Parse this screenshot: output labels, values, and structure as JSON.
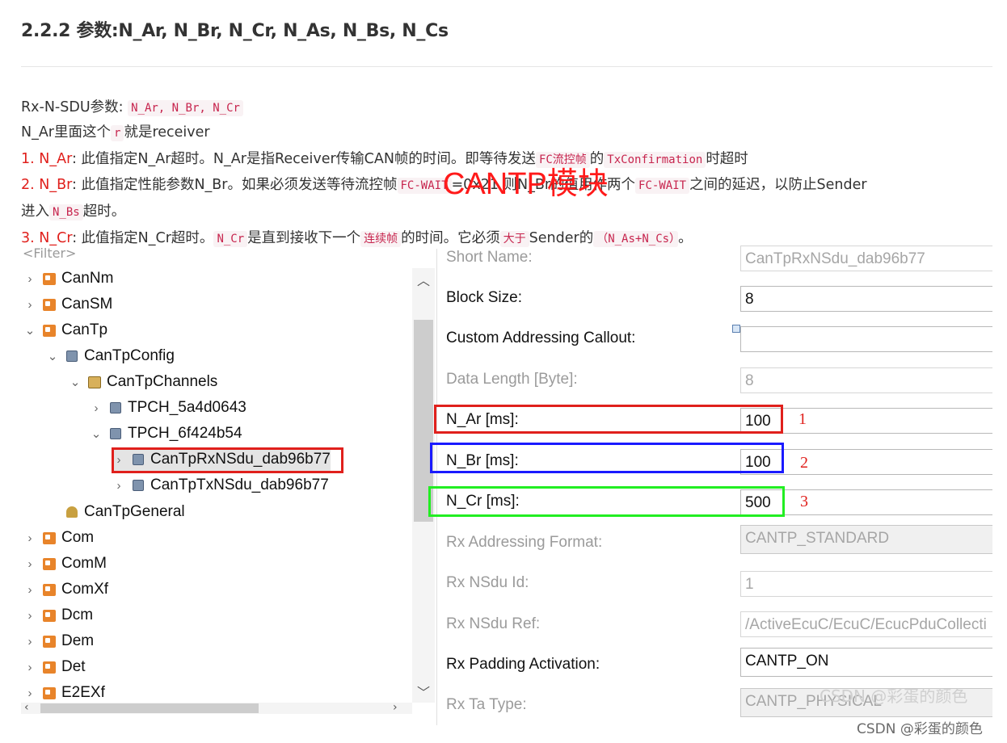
{
  "heading": "2.2.2 参数:N_Ar, N_Br, N_Cr, N_As, N_Bs, N_Cs",
  "text": {
    "l1_prefix": "Rx-N-SDU参数: ",
    "l1_code": "N_Ar, N_Br, N_Cr",
    "l2_prefix": "N_Ar里面这个",
    "l2_code": "r",
    "l2_suffix": "就是receiver",
    "l3_num": "1. N_Ar",
    "l3_a": ": 此值指定N_Ar超时。N_Ar是指Receiver传输CAN帧的时间。即等待发送",
    "l3_code1": "FC流控帧",
    "l3_b": "的",
    "l3_code2": "TxConfirmation",
    "l3_c": "时超时",
    "l4_num": "2. N_Br",
    "l4_a": ": 此值指定性能参数N_Br。如果必须发送等待流控帧",
    "l4_code1": "FC-WAIT",
    "l4_b": "=0x21 则N_Br的值用作两个",
    "l4_code2": "FC-WAIT",
    "l4_c": "之间的延迟，以防止Sender",
    "l5_a": "进入",
    "l5_code": "N_Bs",
    "l5_b": "超时。",
    "l6_num": "3. N_Cr",
    "l6_a": ": 此值指定N_Cr超时。",
    "l6_code1": "N_Cr",
    "l6_b": "是直到接收下一个",
    "l6_code2": "连续帧",
    "l6_c": "的时间。它必须",
    "l6_code3": "大于",
    "l6_d": "Sender的",
    "l6_code4": "（N_As+N_Cs）",
    "l6_e": "。"
  },
  "overlay_title": "CANTP模块",
  "filter_placeholder": "<Filter>",
  "tree": [
    {
      "label": "CanNm",
      "icon": "module-icon"
    },
    {
      "label": "CanSM",
      "icon": "module-icon"
    },
    {
      "label": "CanTp",
      "icon": "module-icon"
    },
    {
      "label": "CanTpConfig",
      "icon": "container-icon"
    },
    {
      "label": "CanTpChannels",
      "icon": "channels-icon"
    },
    {
      "label": "TPCH_5a4d0643",
      "icon": "container-icon"
    },
    {
      "label": "TPCH_6f424b54",
      "icon": "container-icon"
    },
    {
      "label": "CanTpRxNSdu_dab96b77",
      "icon": "container-icon"
    },
    {
      "label": "CanTpTxNSdu_dab96b77",
      "icon": "container-icon"
    },
    {
      "label": "CanTpGeneral",
      "icon": "general-icon"
    },
    {
      "label": "Com",
      "icon": "module-icon"
    },
    {
      "label": "ComM",
      "icon": "module-icon"
    },
    {
      "label": "ComXf",
      "icon": "module-icon"
    },
    {
      "label": "Dcm",
      "icon": "module-icon"
    },
    {
      "label": "Dem",
      "icon": "module-icon"
    },
    {
      "label": "Det",
      "icon": "module-icon"
    },
    {
      "label": "E2EXf",
      "icon": "module-icon"
    }
  ],
  "props": [
    {
      "label": "Short Name:",
      "value": "CanTpRxNSdu_dab96b77",
      "disabled": true
    },
    {
      "label": "Block Size:",
      "value": "8",
      "disabled": false
    },
    {
      "label": "Custom Addressing Callout:",
      "value": "",
      "disabled": false
    },
    {
      "label": "Data Length [Byte]:",
      "value": "8",
      "disabled": true
    },
    {
      "label": "N_Ar [ms]:",
      "value": "100",
      "disabled": false
    },
    {
      "label": "N_Br [ms]:",
      "value": "100",
      "disabled": false
    },
    {
      "label": "N_Cr [ms]:",
      "value": "500",
      "disabled": false
    },
    {
      "label": "Rx Addressing Format:",
      "value": "CANTP_STANDARD",
      "disabled": true
    },
    {
      "label": "Rx NSdu Id:",
      "value": "1",
      "disabled": true
    },
    {
      "label": "Rx NSdu Ref:",
      "value": "/ActiveEcuC/EcuC/EcucPduCollecti",
      "disabled": true
    },
    {
      "label": "Rx Padding Activation:",
      "value": "CANTP_ON",
      "disabled": false
    },
    {
      "label": "Rx Ta Type:",
      "value": "CANTP_PHYSICAL",
      "disabled": true
    }
  ],
  "annotations": [
    "1",
    "2",
    "3"
  ],
  "watermark": "CSDN @彩蛋的颜色",
  "colors": {
    "red": "#e0201c",
    "blue": "#1a1aff",
    "green": "#22ee22"
  }
}
